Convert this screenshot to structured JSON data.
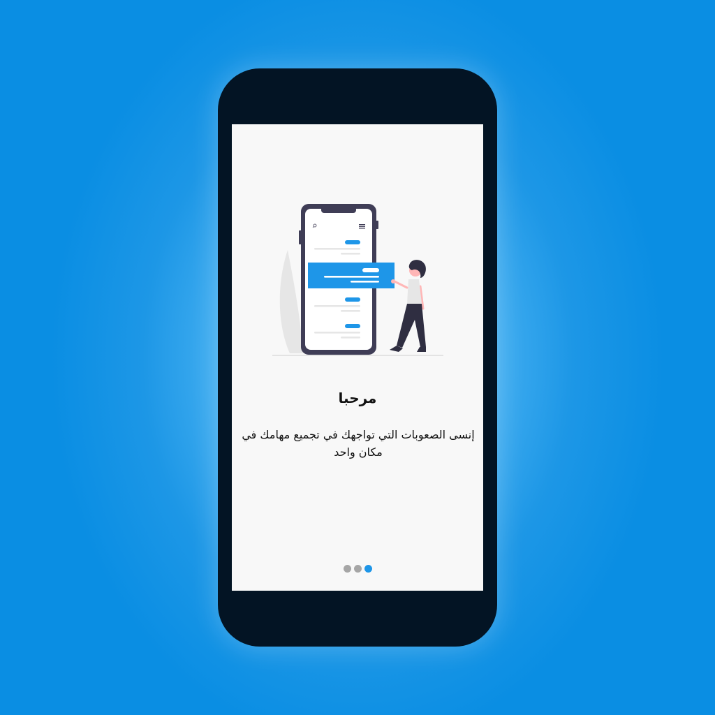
{
  "onboarding": {
    "title": "مرحبا",
    "description": "إنسى الصعوبات التي تواجهك في تجميع مهامك في مكان واحد",
    "illustration": "phone-with-task-cards-and-person-icon"
  },
  "pagination": {
    "total": 3,
    "active_index": 2,
    "dots": [
      "page-1",
      "page-2",
      "page-3"
    ]
  },
  "colors": {
    "accent": "#1e96e8",
    "phone_frame": "#031424",
    "screen_bg": "#f8f8f8",
    "background": "#0a8ee3"
  }
}
